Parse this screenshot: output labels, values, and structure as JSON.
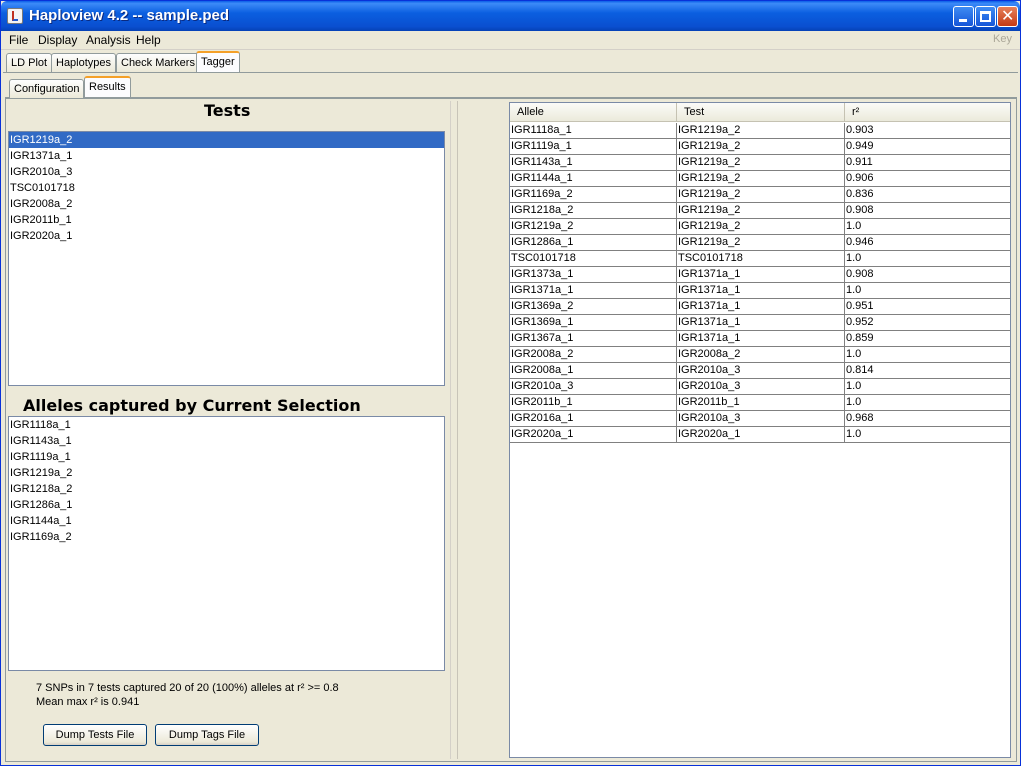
{
  "window": {
    "title": "Haploview 4.2 -- sample.ped"
  },
  "menu": {
    "items": [
      "File",
      "Display",
      "Analysis",
      "Help"
    ],
    "key_label": "Key"
  },
  "main_tabs": [
    "LD Plot",
    "Haplotypes",
    "Check Markers",
    "Tagger"
  ],
  "sub_tabs": [
    "Configuration",
    "Results"
  ],
  "tests": {
    "heading": "Tests",
    "items": [
      "IGR1219a_2",
      "IGR1371a_1",
      "IGR2010a_3",
      "TSC0101718",
      "IGR2008a_2",
      "IGR2011b_1",
      "IGR2020a_1"
    ],
    "selected_index": 0
  },
  "alleles": {
    "heading": "Alleles captured by Current Selection",
    "items": [
      "IGR1118a_1",
      "IGR1143a_1",
      "IGR1119a_1",
      "IGR1219a_2",
      "IGR1218a_2",
      "IGR1286a_1",
      "IGR1144a_1",
      "IGR1169a_2"
    ]
  },
  "summary": {
    "line1": "7 SNPs in 7 tests captured 20 of 20 (100%) alleles at r² >= 0.8",
    "line2": "Mean max r² is 0.941"
  },
  "buttons": {
    "dump_tests": "Dump Tests File",
    "dump_tags": "Dump Tags File"
  },
  "table": {
    "headers": [
      "Allele",
      "Test",
      "r²"
    ],
    "rows": [
      [
        "IGR1118a_1",
        "IGR1219a_2",
        "0.903"
      ],
      [
        "IGR1119a_1",
        "IGR1219a_2",
        "0.949"
      ],
      [
        "IGR1143a_1",
        "IGR1219a_2",
        "0.911"
      ],
      [
        "IGR1144a_1",
        "IGR1219a_2",
        "0.906"
      ],
      [
        "IGR1169a_2",
        "IGR1219a_2",
        "0.836"
      ],
      [
        "IGR1218a_2",
        "IGR1219a_2",
        "0.908"
      ],
      [
        "IGR1219a_2",
        "IGR1219a_2",
        "1.0"
      ],
      [
        "IGR1286a_1",
        "IGR1219a_2",
        "0.946"
      ],
      [
        "TSC0101718",
        "TSC0101718",
        "1.0"
      ],
      [
        "IGR1373a_1",
        "IGR1371a_1",
        "0.908"
      ],
      [
        "IGR1371a_1",
        "IGR1371a_1",
        "1.0"
      ],
      [
        "IGR1369a_2",
        "IGR1371a_1",
        "0.951"
      ],
      [
        "IGR1369a_1",
        "IGR1371a_1",
        "0.952"
      ],
      [
        "IGR1367a_1",
        "IGR1371a_1",
        "0.859"
      ],
      [
        "IGR2008a_2",
        "IGR2008a_2",
        "1.0"
      ],
      [
        "IGR2008a_1",
        "IGR2010a_3",
        "0.814"
      ],
      [
        "IGR2010a_3",
        "IGR2010a_3",
        "1.0"
      ],
      [
        "IGR2011b_1",
        "IGR2011b_1",
        "1.0"
      ],
      [
        "IGR2016a_1",
        "IGR2010a_3",
        "0.968"
      ],
      [
        "IGR2020a_1",
        "IGR2020a_1",
        "1.0"
      ]
    ]
  }
}
